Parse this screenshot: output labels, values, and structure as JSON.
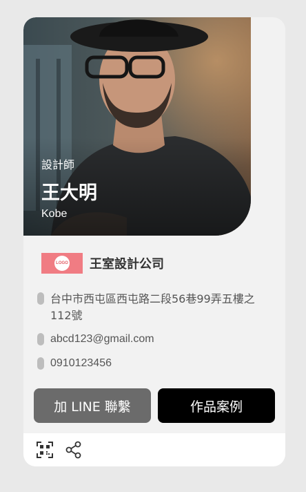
{
  "profile": {
    "job_title": "設計師",
    "name": "王大明",
    "english_name": "Kobe"
  },
  "company": {
    "logo_text": "LOGO",
    "name": "王室設計公司",
    "logo_color": "#f07c83"
  },
  "contact": {
    "address": "台中市西屯區西屯路二段56巷99弄五樓之112號",
    "email": "abcd123@gmail.com",
    "phone": "0910123456"
  },
  "buttons": {
    "line_label": "加 LINE 聯繫",
    "works_label": "作品案例"
  },
  "footer": {
    "icons": [
      "qr-code-icon",
      "share-icon"
    ]
  }
}
